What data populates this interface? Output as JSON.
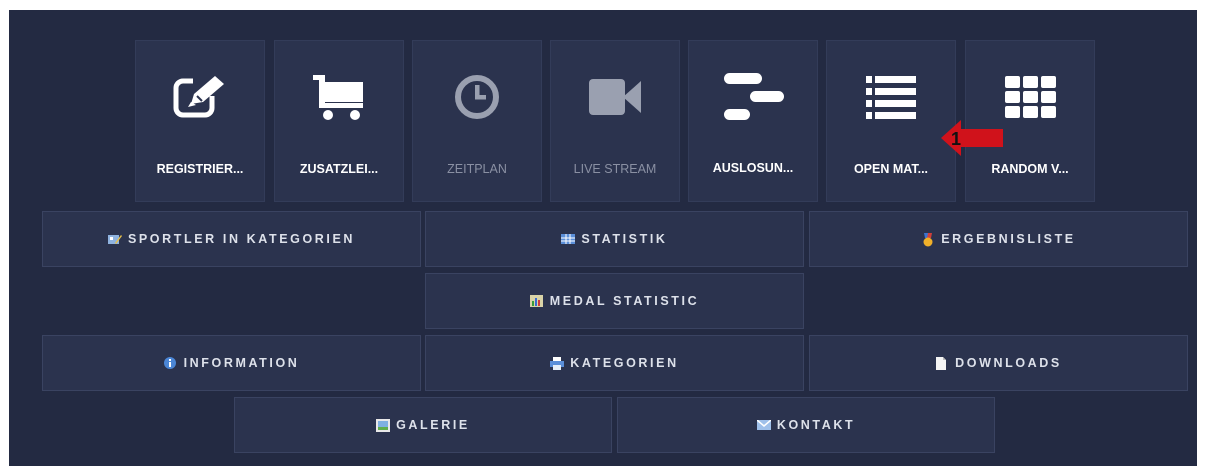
{
  "tiles": [
    {
      "label": "REGISTRIER...",
      "icon": "edit-icon"
    },
    {
      "label": "ZUSATZLEI...",
      "icon": "cart-icon"
    },
    {
      "label": "ZEITPLAN",
      "icon": "clock-icon"
    },
    {
      "label": "LIVE STREAM",
      "icon": "video-camera-icon"
    },
    {
      "label": "AUSLOSUN...",
      "icon": "bracket-icon"
    },
    {
      "label": "OPEN MAT...",
      "icon": "list-icon"
    },
    {
      "label": "RANDOM V...",
      "icon": "grid-icon"
    }
  ],
  "annotation": {
    "number": "1"
  },
  "buttons": {
    "sportler": "SPORTLER IN KATEGORIEN",
    "statistik": "STATISTIK",
    "ergebnisliste": "ERGEBNISLISTE",
    "medal": "MEDAL STATISTIC",
    "information": "INFORMATION",
    "kategorien": "KATEGORIEN",
    "downloads": "DOWNLOADS",
    "galerie": "GALERIE",
    "kontakt": "KONTAKT"
  },
  "colors": {
    "background": "#232a42",
    "tile": "#2b334e",
    "annotation_arrow": "#d0121b",
    "dim_text": "#8a90a3"
  }
}
